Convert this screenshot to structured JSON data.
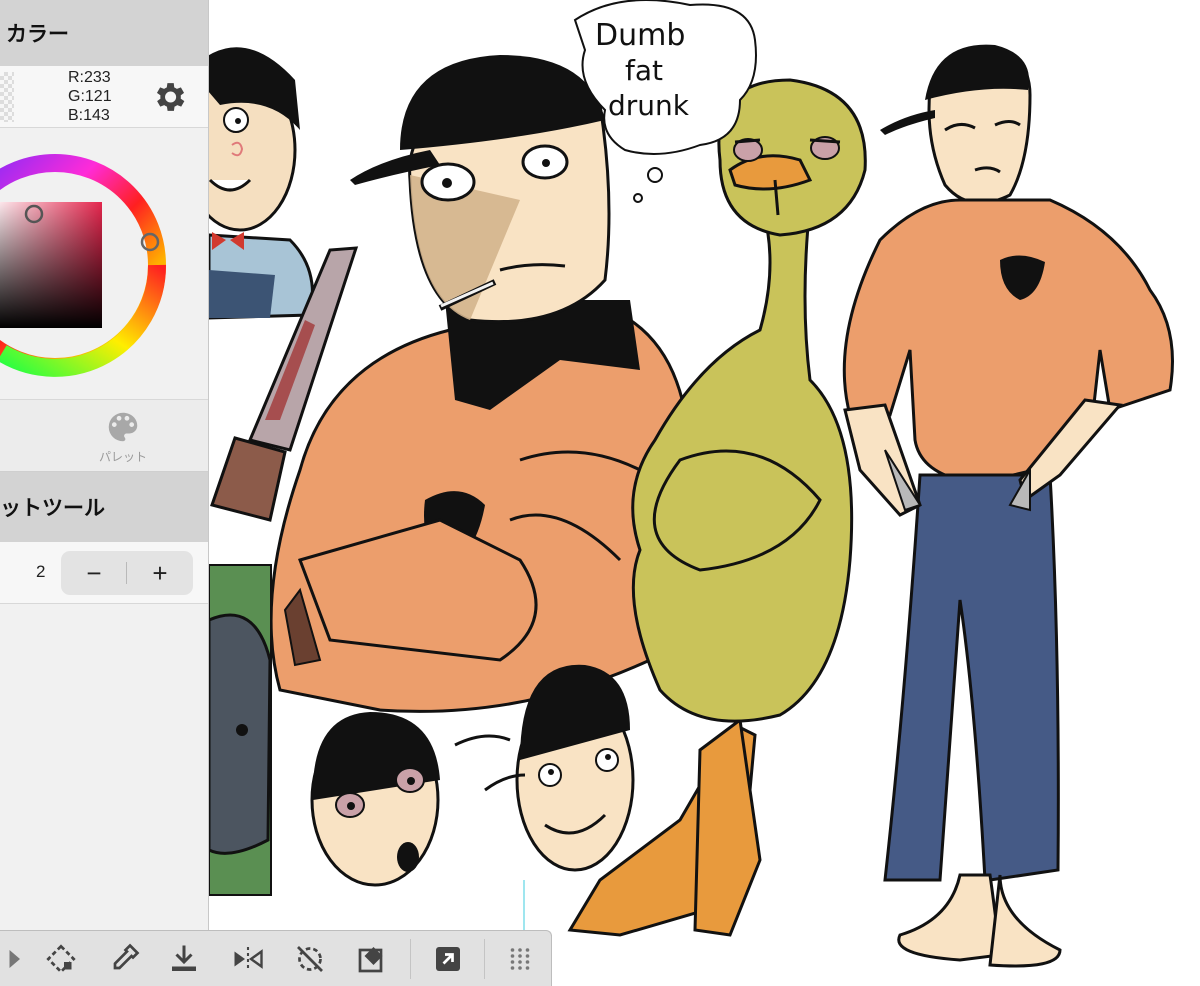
{
  "color_panel": {
    "title": "カラー",
    "rgb": {
      "r": "R:233",
      "g": "G:121",
      "b": "B:143"
    },
    "current_color": "#e9798f",
    "settings_icon": "gear-icon"
  },
  "palette_tab": {
    "label": "パレット",
    "icon": "palette-icon"
  },
  "tool_panel": {
    "title": "ットツール",
    "size_value": "2",
    "minus_label": "−",
    "plus_label": "+"
  },
  "drawing": {
    "speech_bubble": [
      "Dumb",
      "fat",
      "drunk"
    ]
  },
  "toolbar": {
    "icons": [
      "play-icon",
      "transform-icon",
      "eyedropper-icon",
      "download-icon",
      "flip-horizontal-icon",
      "rotate-reset-icon",
      "eraser-icon",
      "export-icon",
      "grid-icon"
    ]
  }
}
